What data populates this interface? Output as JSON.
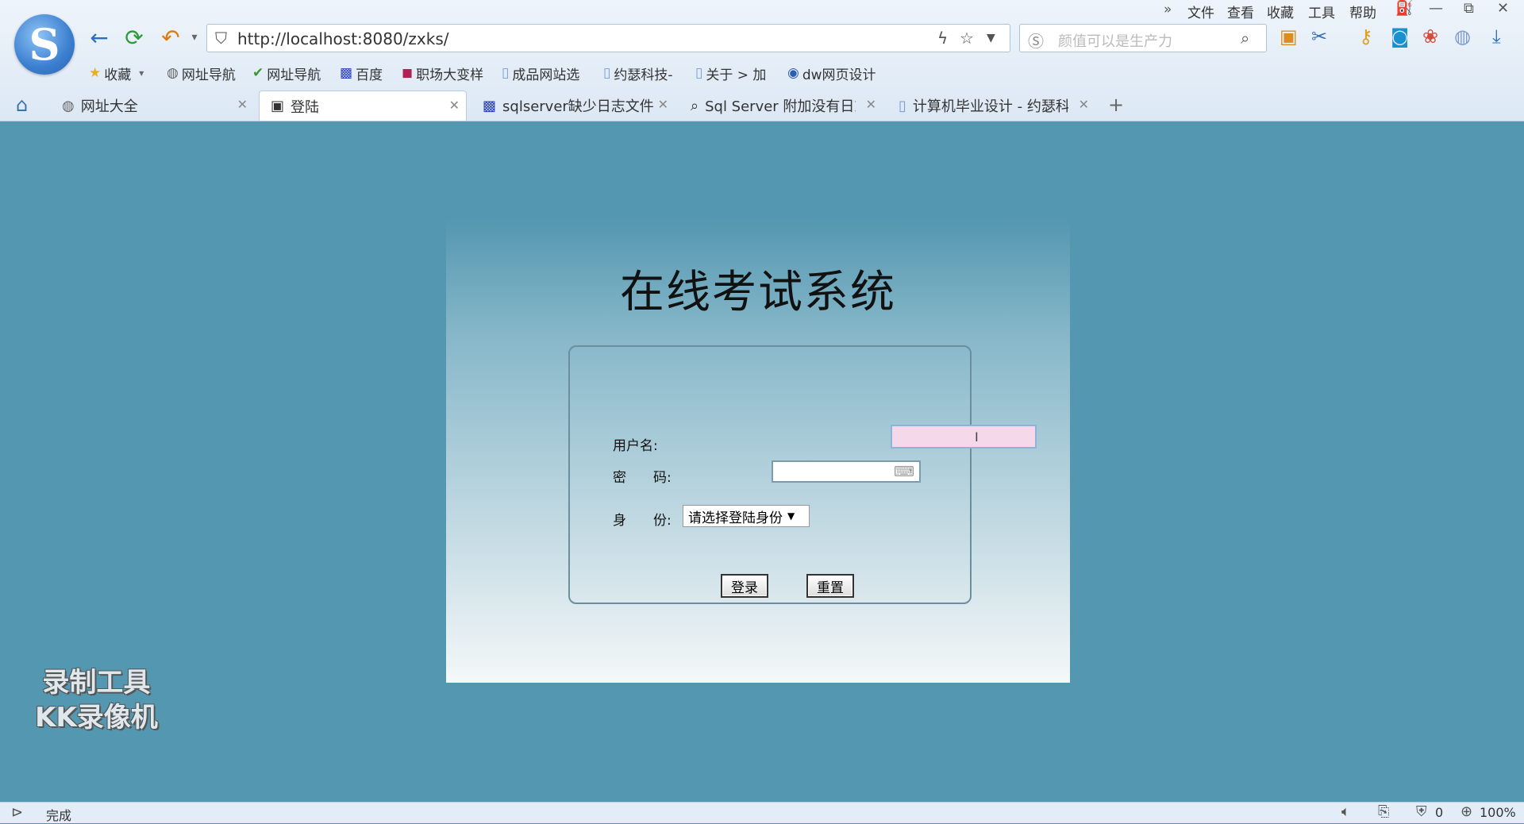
{
  "browser": {
    "address": "http://localhost:8080/zxks/",
    "search_placeholder": "颜值可以是生产力",
    "menu": [
      "文件",
      "查看",
      "收藏",
      "工具",
      "帮助"
    ],
    "bookmarks": [
      "收藏",
      "网址导航",
      "网址导航",
      "百度",
      "职场大变样",
      "成品网站选",
      "约瑟科技-",
      "关于 > 加",
      "dw网页设计"
    ],
    "tabs": [
      "网址大全",
      "登陆",
      "sqlserver缺少日志文件",
      "Sql Server 附加没有日志",
      "计算机毕业设计 - 约瑟科"
    ]
  },
  "page": {
    "title": "在线考试系统",
    "username_label": "用户名:",
    "password_label": "密　　码:",
    "role_label": "身　　份:",
    "role_selected": "请选择登陆身份",
    "login_button": "登录",
    "reset_button": "重置"
  },
  "watermark": {
    "line1": "录制工具",
    "line2": "KK录像机"
  },
  "status": {
    "text": "完成",
    "count": "0",
    "zoom": "100%"
  }
}
